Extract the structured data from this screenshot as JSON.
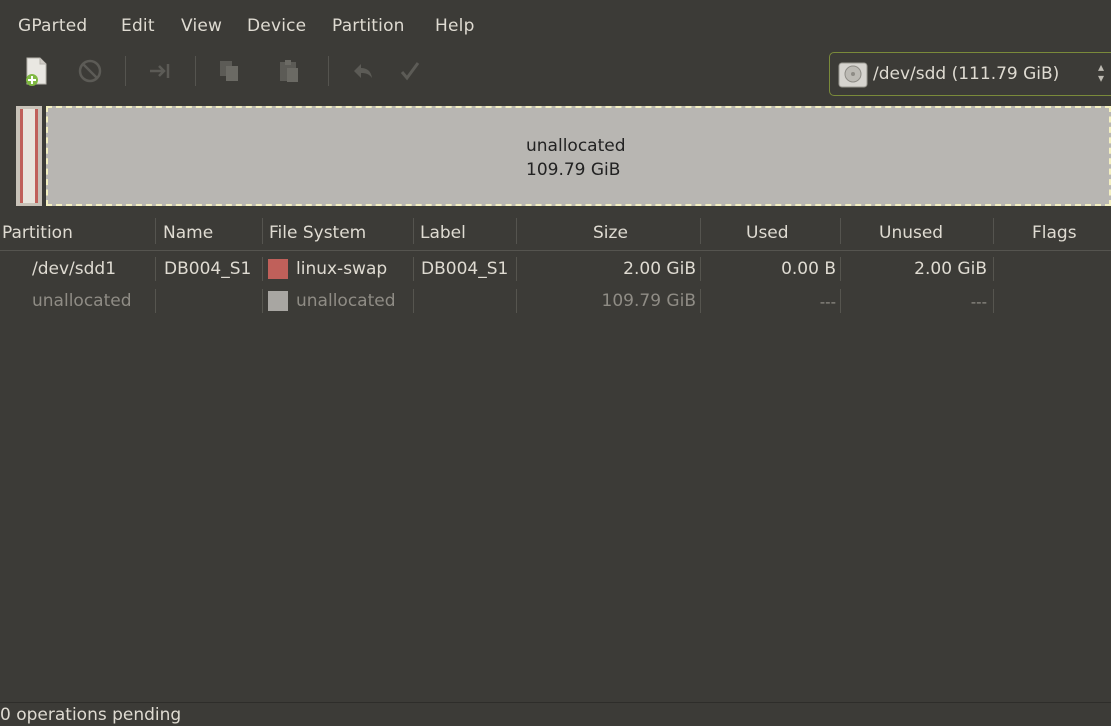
{
  "menubar": {
    "items": [
      "GParted",
      "Edit",
      "View",
      "Device",
      "Partition",
      "Help"
    ]
  },
  "toolbar": {
    "buttons": [
      "new-icon",
      "delete-icon",
      "resize-move-icon",
      "copy-icon",
      "paste-icon",
      "undo-icon",
      "apply-icon"
    ]
  },
  "device_selector": {
    "value": "/dev/sdd  (111.79 GiB)"
  },
  "disk_graph": {
    "unallocated_label": "unallocated",
    "unallocated_size": "109.79 GiB",
    "swap_color": "#c0605a",
    "unallocated_color": "#b8b6b2"
  },
  "table": {
    "headers": [
      "Partition",
      "Name",
      "File System",
      "Label",
      "Size",
      "Used",
      "Unused",
      "Flags"
    ],
    "rows": [
      {
        "partition": "/dev/sdd1",
        "name": "DB004_S1",
        "filesystem": "linux-swap",
        "fs_color": "#c0605a",
        "label": "DB004_S1",
        "size": "2.00 GiB",
        "used": "0.00 B",
        "unused": "2.00 GiB",
        "flags": ""
      },
      {
        "partition": "unallocated",
        "name": "",
        "filesystem": "unallocated",
        "fs_color": "#a8a6a2",
        "label": "",
        "size": "109.79 GiB",
        "used": "---",
        "unused": "---",
        "flags": ""
      }
    ]
  },
  "statusbar": {
    "text": "0 operations pending"
  }
}
